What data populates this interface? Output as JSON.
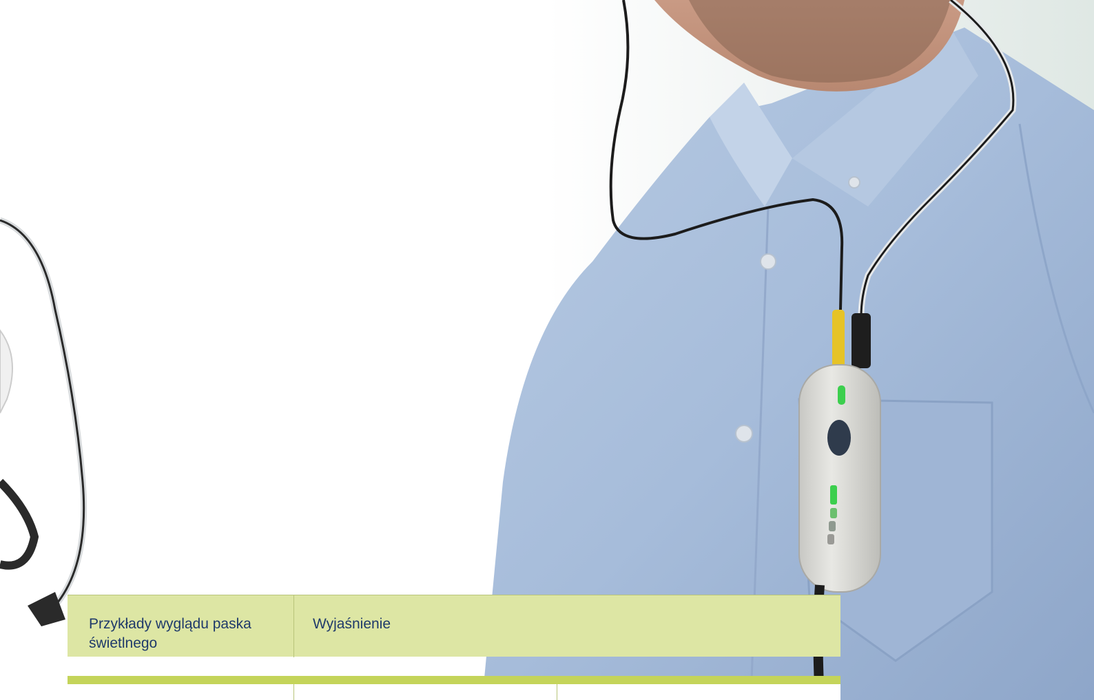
{
  "table": {
    "header_col1": "Przykłady wyglądu paska świetlnego",
    "header_col2": "Wyjaśnienie"
  },
  "colors": {
    "header_bg": "#dde6a4",
    "header_text": "#1f3a6a",
    "accent_rule": "#c4d45a",
    "shirt_blue": "#a9bfdc",
    "device_body": "#dcdcd8",
    "led_green": "#3ccf4e",
    "connector_yellow": "#e8c42a"
  },
  "icons": {
    "photo": "man-wearing-device-photo",
    "device": "monitoring-device-icon",
    "button": "device-button-icon",
    "led_indicator": "led-indicator-icon",
    "light_bar": "light-bar-icon",
    "sensor": "nasal-sensor-icon"
  }
}
